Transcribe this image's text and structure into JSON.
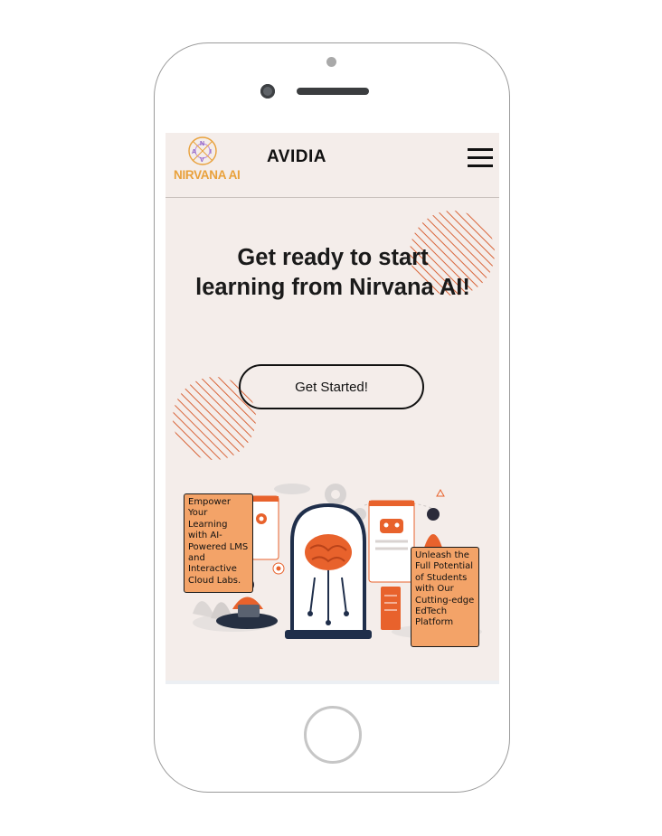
{
  "app": {
    "logo_text": "NIRVANA AI",
    "logo_letters": [
      "N",
      "A",
      "I",
      "V"
    ],
    "brand_name": "AVIDIA"
  },
  "hero": {
    "title": "Get ready to start learning from Nirvana AI!",
    "cta_label": "Get Started!"
  },
  "callouts": {
    "left": "Empower Your Learning with AI-Powered LMS and Interactive Cloud Labs.",
    "right": "Unleash the Full Potential of Students with Our Cutting-edge EdTech Platform"
  },
  "colors": {
    "accent": "#e8622c",
    "logo": "#e9a13b",
    "background": "#f4edea",
    "callout_bg": "#f3a368",
    "ink": "#111111"
  },
  "icons": {
    "menu": "hamburger-menu-icon"
  }
}
